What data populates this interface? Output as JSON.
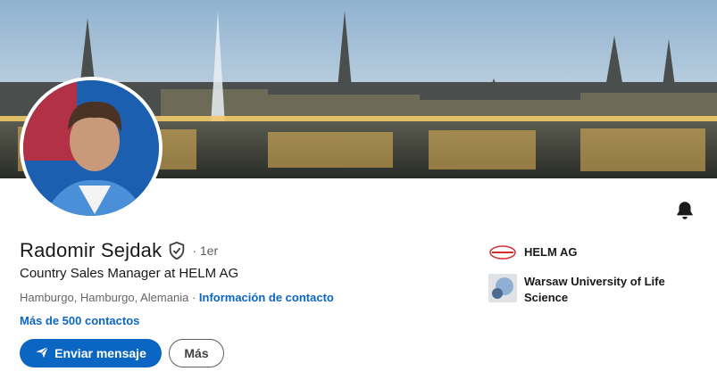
{
  "profile": {
    "name": "Radomir Sejdak",
    "degree": "· 1er",
    "headline": "Country Sales Manager at HELM AG",
    "location": "Hamburgo, Hamburgo, Alemania",
    "separator": " · ",
    "contact_info": "Información de contacto",
    "connections": "Más de 500 contactos"
  },
  "actions": {
    "message_label": "Enviar mensaje",
    "more_label": "Más"
  },
  "organizations": [
    {
      "name": "HELM AG",
      "logo": "helm-logo",
      "logo_text": "HELM"
    },
    {
      "name": "Warsaw University of Life Science",
      "logo": "university-logo"
    }
  ],
  "icons": {
    "verified": "shield-check-icon",
    "bell": "bell-icon",
    "send": "paper-plane-icon"
  },
  "colors": {
    "primary": "#0a66c2",
    "text": "#191919",
    "muted": "#666666"
  }
}
